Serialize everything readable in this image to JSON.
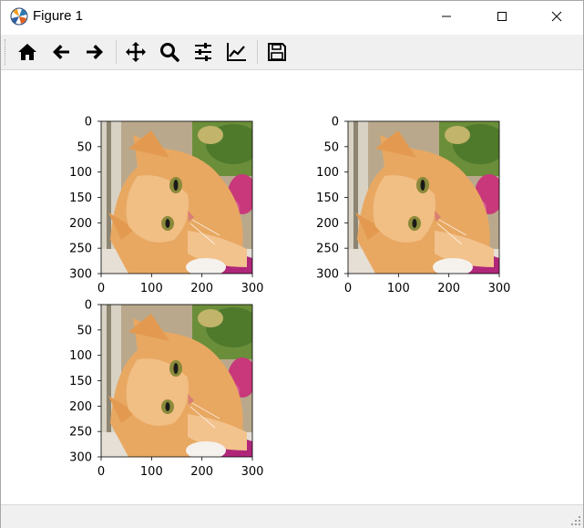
{
  "window": {
    "title": "Figure 1",
    "app_icon": "matplotlib-logo-icon",
    "controls": [
      "minimize-icon",
      "maximize-icon",
      "close-icon"
    ]
  },
  "toolbar": {
    "buttons": [
      {
        "name": "home-button",
        "icon": "home-icon",
        "label": "Home"
      },
      {
        "name": "back-button",
        "icon": "arrow-left-icon",
        "label": "Back"
      },
      {
        "name": "forward-button",
        "icon": "arrow-right-icon",
        "label": "Forward"
      },
      {
        "name": "pan-button",
        "icon": "move-icon",
        "label": "Pan"
      },
      {
        "name": "zoom-button",
        "icon": "magnifier-icon",
        "label": "Zoom"
      },
      {
        "name": "subplots-button",
        "icon": "sliders-icon",
        "label": "Configure subplots"
      },
      {
        "name": "edit-axes-button",
        "icon": "line-chart-icon",
        "label": "Edit axis"
      },
      {
        "name": "save-button",
        "icon": "floppy-disk-icon",
        "label": "Save"
      }
    ]
  },
  "figure": {
    "subplots": [
      {
        "id": "subplot-1",
        "image": "orange tabby kitten photo",
        "x_ticks": [
          "0",
          "100",
          "200",
          "300"
        ],
        "y_ticks": [
          "0",
          "50",
          "100",
          "150",
          "200",
          "250",
          "300"
        ]
      },
      {
        "id": "subplot-2",
        "image": "orange tabby kitten photo",
        "x_ticks": [
          "0",
          "100",
          "200",
          "300"
        ],
        "y_ticks": [
          "0",
          "50",
          "100",
          "150",
          "200",
          "250",
          "300"
        ]
      },
      {
        "id": "subplot-3",
        "image": "orange tabby kitten photo",
        "x_ticks": [
          "0",
          "100",
          "200",
          "300"
        ],
        "y_ticks": [
          "0",
          "50",
          "100",
          "150",
          "200",
          "250",
          "300"
        ]
      }
    ]
  },
  "colors": {
    "toolbar_bg": "#f0f0f0",
    "cat_fur": "#e8a862",
    "cat_eye": "#8a8a3a",
    "background_green": "#6b8e3a",
    "background_pink": "#c8387a"
  }
}
